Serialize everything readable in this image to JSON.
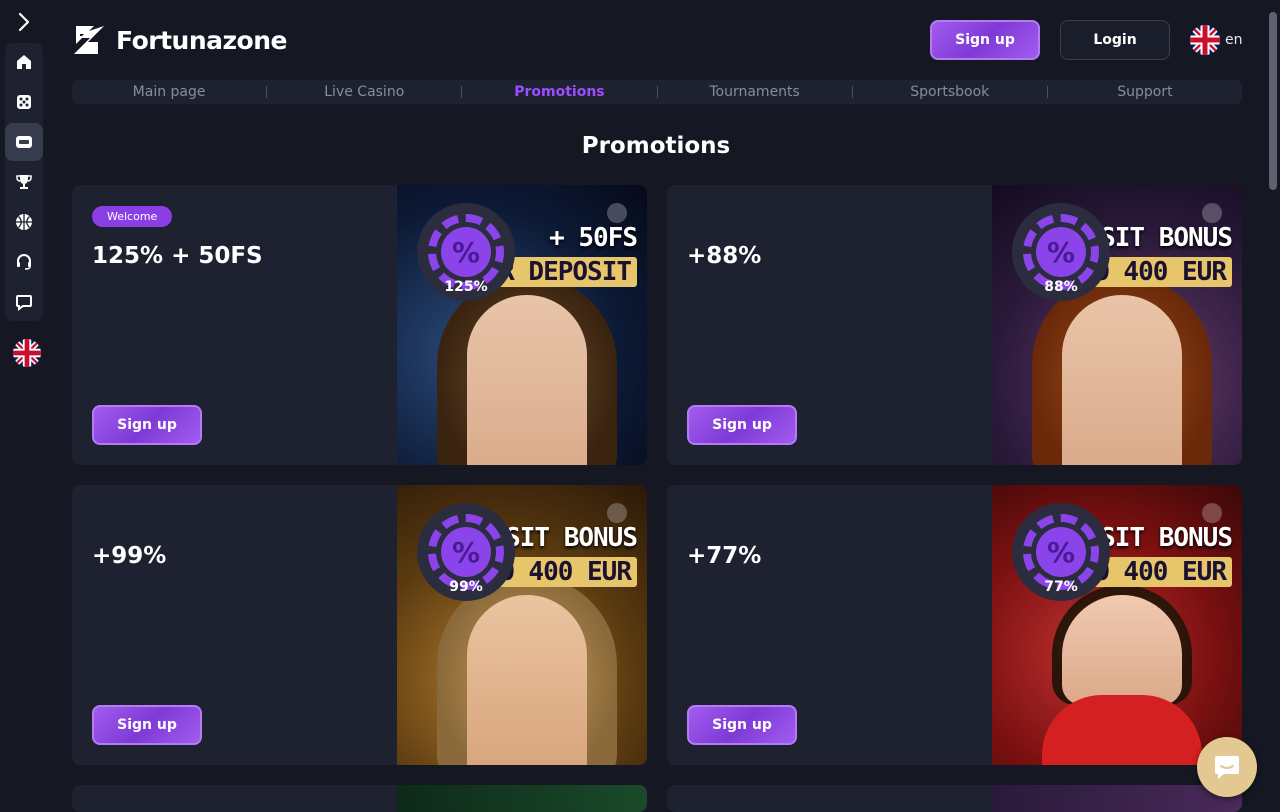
{
  "brand": {
    "name": "Fortunazone"
  },
  "header": {
    "signup_label": "Sign up",
    "login_label": "Login",
    "language_code": "en"
  },
  "sidebar": {
    "items": [
      {
        "icon": "home-icon",
        "active": false
      },
      {
        "icon": "dice-icon",
        "active": false
      },
      {
        "icon": "ticket-icon",
        "active": true
      },
      {
        "icon": "trophy-icon",
        "active": false
      },
      {
        "icon": "basketball-icon",
        "active": false
      },
      {
        "icon": "headset-icon",
        "active": false
      },
      {
        "icon": "chat-bubble-icon",
        "active": false
      }
    ]
  },
  "nav": {
    "items": [
      {
        "label": "Main page",
        "active": false
      },
      {
        "label": "Live Casino",
        "active": false
      },
      {
        "label": "Promotions",
        "active": true
      },
      {
        "label": "Tournaments",
        "active": false
      },
      {
        "label": "Sportsbook",
        "active": false
      },
      {
        "label": "Support",
        "active": false
      }
    ]
  },
  "page": {
    "title": "Promotions"
  },
  "promotions": [
    {
      "badge": "Welcome",
      "title": "125% + 50FS",
      "button": "Sign up",
      "chip_label": "125%",
      "banner_line1": "+ 50FS",
      "banner_line2": "EUR DEPOSIT"
    },
    {
      "badge": "",
      "title": "+88%",
      "button": "Sign up",
      "chip_label": "88%",
      "banner_line1": "DEPOSIT BONUS",
      "banner_line2": "TO 400 EUR"
    },
    {
      "badge": "",
      "title": "+99%",
      "button": "Sign up",
      "chip_label": "99%",
      "banner_line1": "DEPOSIT BONUS",
      "banner_line2": "TO 400 EUR"
    },
    {
      "badge": "",
      "title": "+77%",
      "button": "Sign up",
      "chip_label": "77%",
      "banner_line1": "DEPOSIT BONUS",
      "banner_line2": "TO 400 EUR"
    }
  ],
  "colors": {
    "background": "#151823",
    "panel": "#1e2230",
    "accent": "#9b4dff",
    "chat_button": "#e3c991"
  }
}
